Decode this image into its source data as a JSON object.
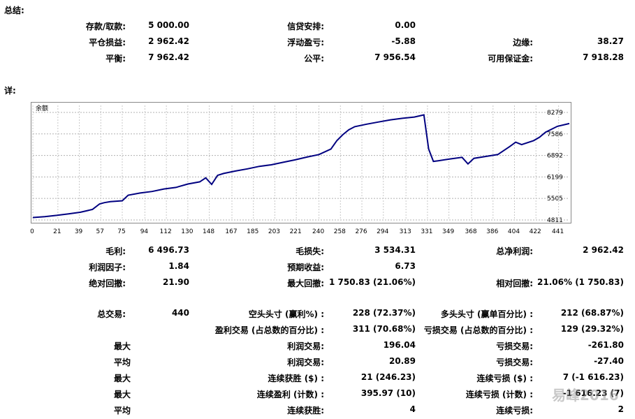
{
  "summary": {
    "title": "总结:",
    "deposit_label": "存款/取款:",
    "deposit_value": "5 000.00",
    "credit_label": "信贷安排:",
    "credit_value": "0.00",
    "closed_pl_label": "平仓损益:",
    "closed_pl_value": "2 962.42",
    "floating_pl_label": "浮动盈亏:",
    "floating_pl_value": "-5.88",
    "margin_label": "边缘:",
    "margin_value": "38.27",
    "balance_label": "平衡:",
    "balance_value": "7 962.42",
    "equity_label": "公平:",
    "equity_value": "7 956.54",
    "free_margin_label": "可用保证金:",
    "free_margin_value": "7 918.28"
  },
  "details": {
    "title": "详:"
  },
  "chart_data": {
    "type": "line",
    "title": "余额",
    "line_color": "#000080",
    "ylim": [
      4811,
      8279
    ],
    "yticks": [
      "8279",
      "7586",
      "6892",
      "6199",
      "5505",
      "4811"
    ],
    "xlim": [
      0,
      450
    ],
    "xticks": [
      "0",
      "21",
      "39",
      "57",
      "75",
      "94",
      "112",
      "130",
      "148",
      "167",
      "185",
      "203",
      "221",
      "240",
      "258",
      "276",
      "294",
      "313",
      "331",
      "349",
      "368",
      "386",
      "404",
      "422",
      "441"
    ],
    "grid": true,
    "series": [
      {
        "x": [
          0,
          10,
          20,
          30,
          40,
          50,
          56,
          60,
          65,
          75,
          80,
          90,
          100,
          110,
          120,
          130,
          140,
          145,
          150,
          155,
          160,
          170,
          180,
          190,
          200,
          210,
          220,
          230,
          240,
          250,
          255,
          260,
          265,
          270,
          280,
          290,
          300,
          310,
          320,
          328,
          332,
          336,
          340,
          350,
          360,
          365,
          370,
          380,
          390,
          400,
          405,
          410,
          420,
          425,
          430,
          440,
          450
        ],
        "y": [
          4890,
          4920,
          4960,
          5010,
          5060,
          5150,
          5330,
          5370,
          5400,
          5430,
          5610,
          5680,
          5730,
          5810,
          5860,
          5970,
          6040,
          6170,
          5960,
          6250,
          6310,
          6390,
          6460,
          6540,
          6590,
          6670,
          6750,
          6840,
          6920,
          7100,
          7370,
          7560,
          7720,
          7820,
          7900,
          7970,
          8040,
          8090,
          8130,
          8200,
          7100,
          6700,
          6720,
          6780,
          6830,
          6620,
          6800,
          6860,
          6920,
          7180,
          7320,
          7240,
          7370,
          7480,
          7640,
          7830,
          7920
        ]
      }
    ]
  },
  "stats": {
    "gross_profit_label": "毛利:",
    "gross_profit_value": "6 496.73",
    "gross_loss_label": "毛损失:",
    "gross_loss_value": "3 534.31",
    "net_profit_label": "总净利润:",
    "net_profit_value": "2 962.42",
    "profit_factor_label": "利润因子:",
    "profit_factor_value": "1.84",
    "expected_payoff_label": "预期收益:",
    "expected_payoff_value": "6.73",
    "abs_dd_label": "绝对回撤:",
    "abs_dd_value": "21.90",
    "max_dd_label": "最大回撤:",
    "max_dd_value": "1 750.83 (21.06%)",
    "rel_dd_label": "相对回撤:",
    "rel_dd_value": "21.06% (1 750.83)",
    "total_trades_label": "总交易:",
    "total_trades_value": "440",
    "short_label": "空头头寸 (赢利%) :",
    "short_value": "228 (72.37%)",
    "long_label": "多头头寸 (赢单百分比) :",
    "long_value": "212 (68.87%)",
    "profit_trades_label": "盈利交易 (占总数的百分比) :",
    "profit_trades_value": "311 (70.68%)",
    "loss_trades_label": "亏损交易 (占总数的百分比) :",
    "loss_trades_value": "129 (29.32%)",
    "row_largest1": "最大",
    "largest_profit_label": "利润交易:",
    "largest_profit_value": "196.04",
    "largest_loss_label": "亏损交易:",
    "largest_loss_value": "-261.80",
    "row_average1": "平均",
    "avg_profit_label": "利润交易:",
    "avg_profit_value": "20.89",
    "avg_loss_label": "亏损交易:",
    "avg_loss_value": "-27.40",
    "row_max1": "最大",
    "max_consec_wins_label": "连续获胜 ($) :",
    "max_consec_wins_value": "21 (246.23)",
    "max_consec_losses_label": "连续亏损 ($) :",
    "max_consec_losses_value": "7 (-1 616.23)",
    "row_max2": "最大",
    "max_consec_profit_label": "连续盈利 (计数) :",
    "max_consec_profit_value": "395.97 (10)",
    "max_consec_loss_label": "连续亏损 (计数) :",
    "max_consec_loss_value": "-1 616.23 (7)",
    "row_average2": "平均",
    "avg_consec_wins_label": "连续获胜:",
    "avg_consec_wins_value": "4",
    "avg_consec_losses_label": "连续亏损:",
    "avg_consec_losses_value": "2"
  },
  "watermark": "易峰2016"
}
